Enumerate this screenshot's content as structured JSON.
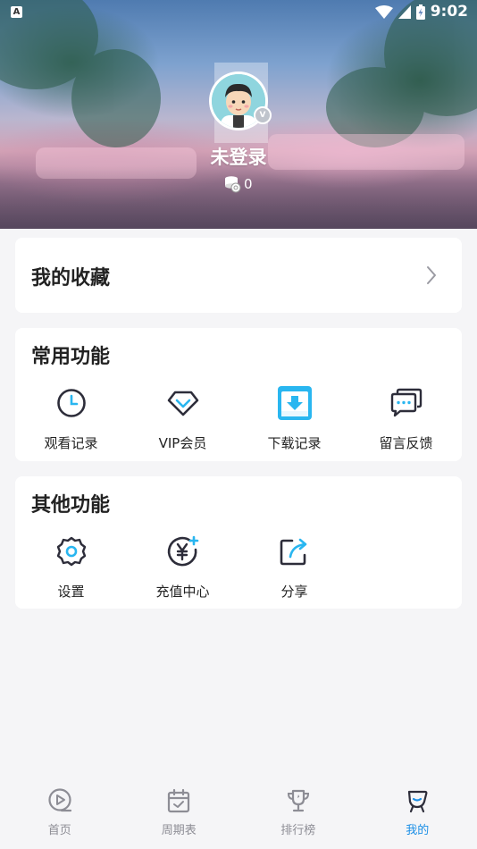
{
  "status_bar": {
    "time": "9:02",
    "left_badge": "A"
  },
  "profile": {
    "username": "未登录",
    "coin_count": "0"
  },
  "favorites": {
    "title": "我的收藏"
  },
  "common_functions": {
    "title": "常用功能",
    "items": [
      {
        "label": "观看记录",
        "icon": "clock-icon"
      },
      {
        "label": "VIP会员",
        "icon": "diamond-icon"
      },
      {
        "label": "下载记录",
        "icon": "download-icon"
      },
      {
        "label": "留言反馈",
        "icon": "message-icon"
      }
    ]
  },
  "other_functions": {
    "title": "其他功能",
    "items": [
      {
        "label": "设置",
        "icon": "gear-icon"
      },
      {
        "label": "充值中心",
        "icon": "yuan-recharge-icon"
      },
      {
        "label": "分享",
        "icon": "share-icon"
      }
    ]
  },
  "bottom_nav": {
    "items": [
      {
        "label": "首页",
        "icon": "play-circle-icon",
        "active": false
      },
      {
        "label": "周期表",
        "icon": "calendar-icon",
        "active": false
      },
      {
        "label": "排行榜",
        "icon": "trophy-icon",
        "active": false
      },
      {
        "label": "我的",
        "icon": "profile-icon",
        "active": true
      }
    ]
  },
  "colors": {
    "accent": "#1c8fe6",
    "icon_dark": "#2d2d3a",
    "download_tile": "#29b6f0",
    "inactive_nav": "#8d8d95"
  }
}
